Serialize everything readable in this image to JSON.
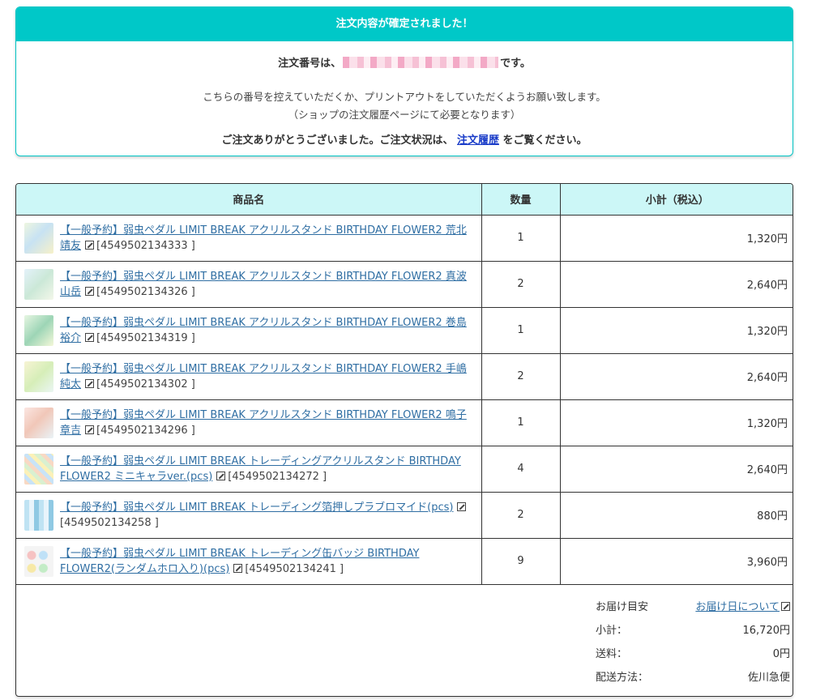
{
  "confirmation": {
    "header": "注文内容が確定されました！",
    "order_prefix": "注文番号は、",
    "order_suffix": "です。",
    "note_line1": "こちらの番号を控えていただくか、プリントアウトをしていただくようお願い致します。",
    "note_line2": "（ショップの注文履歴ページにて必要となります）",
    "thanks_prefix": "ご注文ありがとうございました。ご注文状況は、",
    "history_link": "注文履歴",
    "thanks_suffix": "をご覧ください。"
  },
  "table": {
    "headers": {
      "name": "商品名",
      "qty": "数量",
      "subtotal": "小計（税込）"
    },
    "rows": [
      {
        "title": "【一般予約】弱虫ペダル LIMIT BREAK アクリルスタンド BIRTHDAY FLOWER2 荒北靖友",
        "jan": "[4549502134333 ]",
        "qty": "1",
        "subtotal": "1,320円"
      },
      {
        "title": "【一般予約】弱虫ペダル LIMIT BREAK アクリルスタンド BIRTHDAY FLOWER2 真波山岳",
        "jan": "[4549502134326 ]",
        "qty": "2",
        "subtotal": "2,640円"
      },
      {
        "title": "【一般予約】弱虫ペダル LIMIT BREAK アクリルスタンド BIRTHDAY FLOWER2 巻島裕介",
        "jan": "[4549502134319 ]",
        "qty": "1",
        "subtotal": "1,320円"
      },
      {
        "title": "【一般予約】弱虫ペダル LIMIT BREAK アクリルスタンド BIRTHDAY FLOWER2 手嶋純太",
        "jan": "[4549502134302 ]",
        "qty": "2",
        "subtotal": "2,640円"
      },
      {
        "title": "【一般予約】弱虫ペダル LIMIT BREAK アクリルスタンド BIRTHDAY FLOWER2 鳴子章吉",
        "jan": "[4549502134296 ]",
        "qty": "1",
        "subtotal": "1,320円"
      },
      {
        "title": "【一般予約】弱虫ペダル LIMIT BREAK トレーディングアクリルスタンド BIRTHDAY FLOWER2 ミニキャラver.(pcs)",
        "jan": "[4549502134272 ]",
        "qty": "4",
        "subtotal": "2,640円"
      },
      {
        "title": "【一般予約】弱虫ペダル LIMIT BREAK トレーディング箔押しプラブロマイド(pcs)",
        "jan": "[4549502134258 ]",
        "qty": "2",
        "subtotal": "880円"
      },
      {
        "title": "【一般予約】弱虫ペダル LIMIT BREAK トレーディング缶バッジ BIRTHDAY FLOWER2(ランダムホロ入り)(pcs)",
        "jan": "[4549502134241 ]",
        "qty": "9",
        "subtotal": "3,960円"
      }
    ]
  },
  "summary": {
    "delivery_label": "お届け目安",
    "delivery_link": "お届け日について",
    "subtotal_label": "小計：",
    "subtotal_value": "16,720円",
    "shipping_label": "送料：",
    "shipping_value": "0円",
    "method_label": "配送方法：",
    "method_value": "佐川急便"
  },
  "icons": {
    "external_link": "external-link-icon"
  },
  "colors": {
    "accent": "#00c8c8",
    "header_bg": "#ccf7f7",
    "link": "#2f6ea3"
  }
}
